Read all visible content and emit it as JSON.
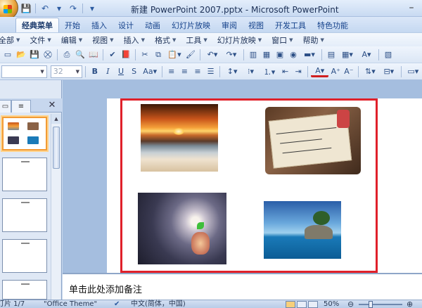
{
  "window": {
    "title": "新建 PowerPoint 2007.pptx - Microsoft PowerPoint",
    "minimize_glyph": "–"
  },
  "quick_access": [
    {
      "name": "save-icon",
      "glyph": "💾"
    },
    {
      "name": "undo-icon",
      "glyph": "↶"
    },
    {
      "name": "undo-dropdown-icon",
      "glyph": "▾"
    },
    {
      "name": "redo-icon",
      "glyph": "↷"
    },
    {
      "name": "customize-qat-icon",
      "glyph": "▾"
    }
  ],
  "ribbon_tabs": [
    "经典菜单",
    "开始",
    "插入",
    "设计",
    "动画",
    "幻灯片放映",
    "审阅",
    "视图",
    "开发工具",
    "特色功能"
  ],
  "active_tab": 0,
  "menu_items": [
    "全部",
    "文件",
    "编辑",
    "视图",
    "插入",
    "格式",
    "工具",
    "幻灯片放映",
    "窗口",
    "帮助"
  ],
  "toolbar": {
    "font_name": "",
    "font_size": "32"
  },
  "left_pane": {
    "close_glyph": "✕",
    "outline_tab_glyph": "≡"
  },
  "notes": {
    "placeholder": "单击此处添加备注"
  },
  "status": {
    "slide": "灯片 1/7",
    "theme": "\"Office Theme\"",
    "language": "中文(简体，中国)",
    "zoom": "50%",
    "zoom_out": "⊖",
    "zoom_in": "⊕"
  },
  "colors": {
    "highlight_border": "#e0202a",
    "selected_thumb": "#f29b36"
  }
}
